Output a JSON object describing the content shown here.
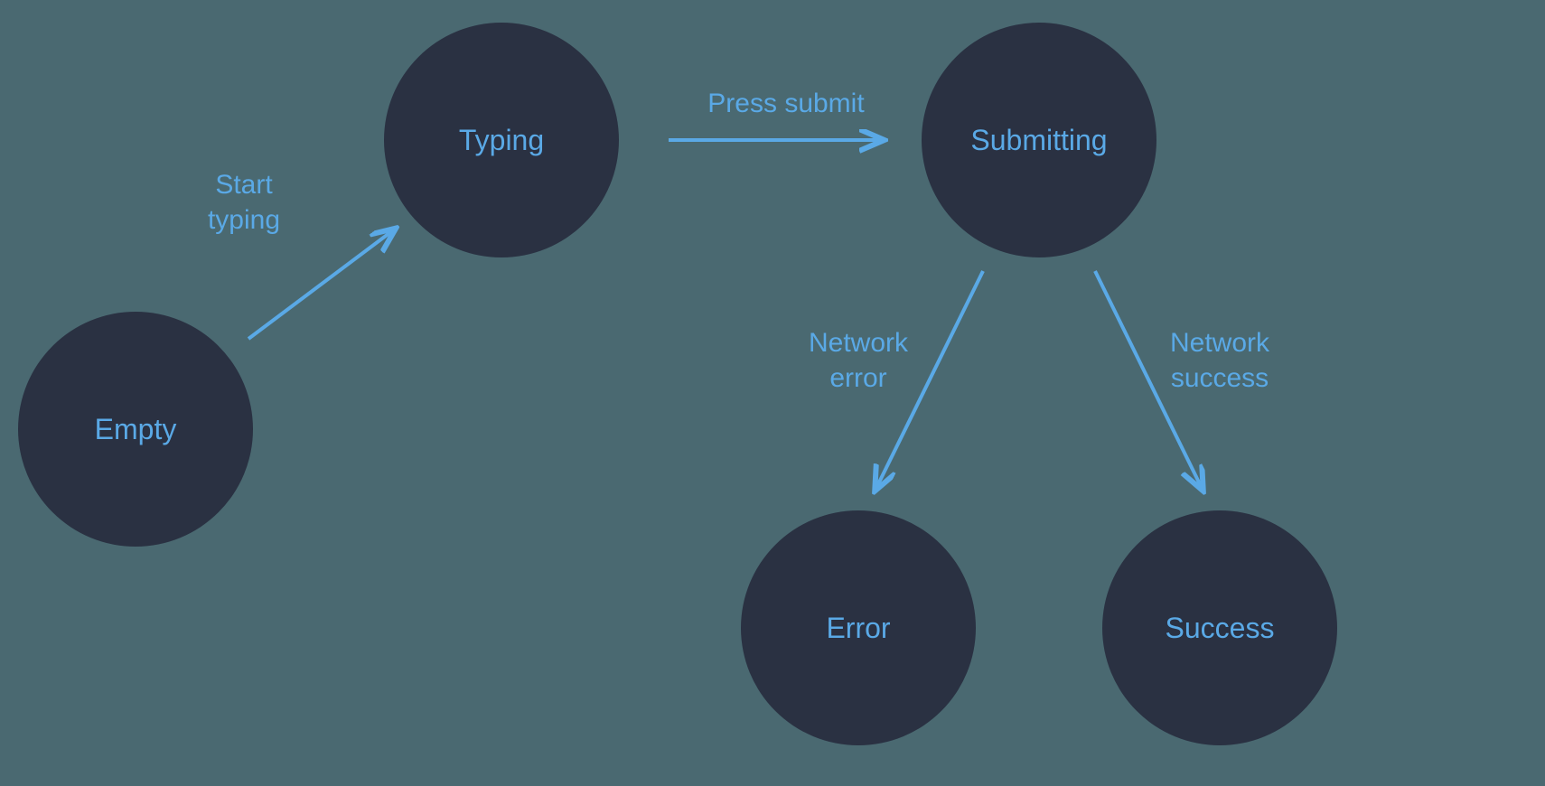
{
  "states": {
    "empty": "Empty",
    "typing": "Typing",
    "submitting": "Submitting",
    "error": "Error",
    "success": "Success"
  },
  "transitions": {
    "start_typing_line1": "Start",
    "start_typing_line2": "typing",
    "press_submit": "Press submit",
    "network_error_line1": "Network",
    "network_error_line2": "error",
    "network_success_line1": "Network",
    "network_success_line2": "success"
  },
  "colors": {
    "background": "#4a6971",
    "node_fill": "#2a3142",
    "accent": "#5aa9e6"
  }
}
